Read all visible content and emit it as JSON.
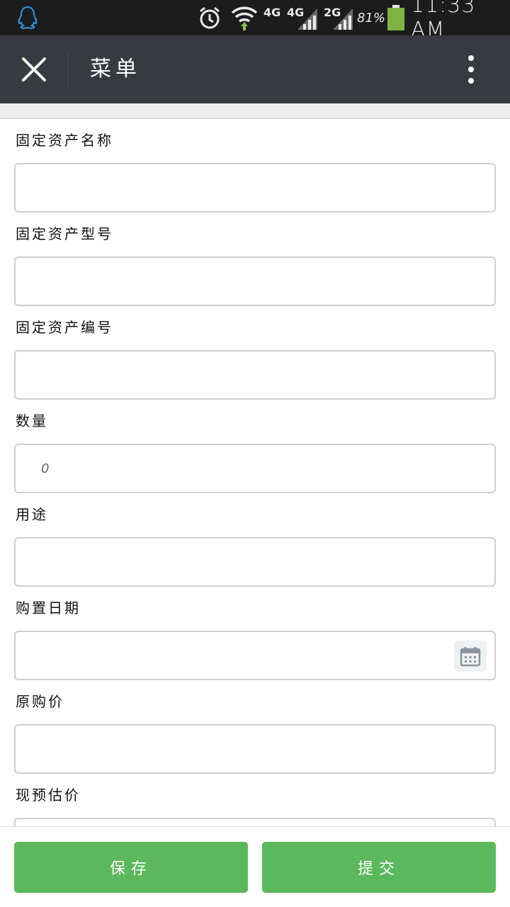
{
  "status_bar": {
    "network_1": "4G",
    "network_2": "4G",
    "network_3": "2G",
    "battery": "81%",
    "time": "11:33 AM"
  },
  "title_bar": {
    "title": "菜单",
    "close_icon": "close-icon",
    "more_icon": "more-vertical-icon"
  },
  "form": {
    "fields": [
      {
        "label": "固定资产名称",
        "value": "",
        "placeholder": ""
      },
      {
        "label": "固定资产型号",
        "value": "",
        "placeholder": ""
      },
      {
        "label": "固定资产编号",
        "value": "",
        "placeholder": ""
      },
      {
        "label": "数量",
        "value": "",
        "placeholder": "0"
      },
      {
        "label": "用途",
        "value": "",
        "placeholder": ""
      },
      {
        "label": "购置日期",
        "value": "",
        "placeholder": ""
      },
      {
        "label": "原购价",
        "value": "",
        "placeholder": ""
      },
      {
        "label": "现预估价",
        "value": "",
        "placeholder": ""
      }
    ]
  },
  "actions": {
    "save": "保存",
    "submit": "提交"
  },
  "colors": {
    "status_bar_bg": "#1c1c1c",
    "title_bar_bg": "#393a3f",
    "button_green": "#5cb85c"
  }
}
